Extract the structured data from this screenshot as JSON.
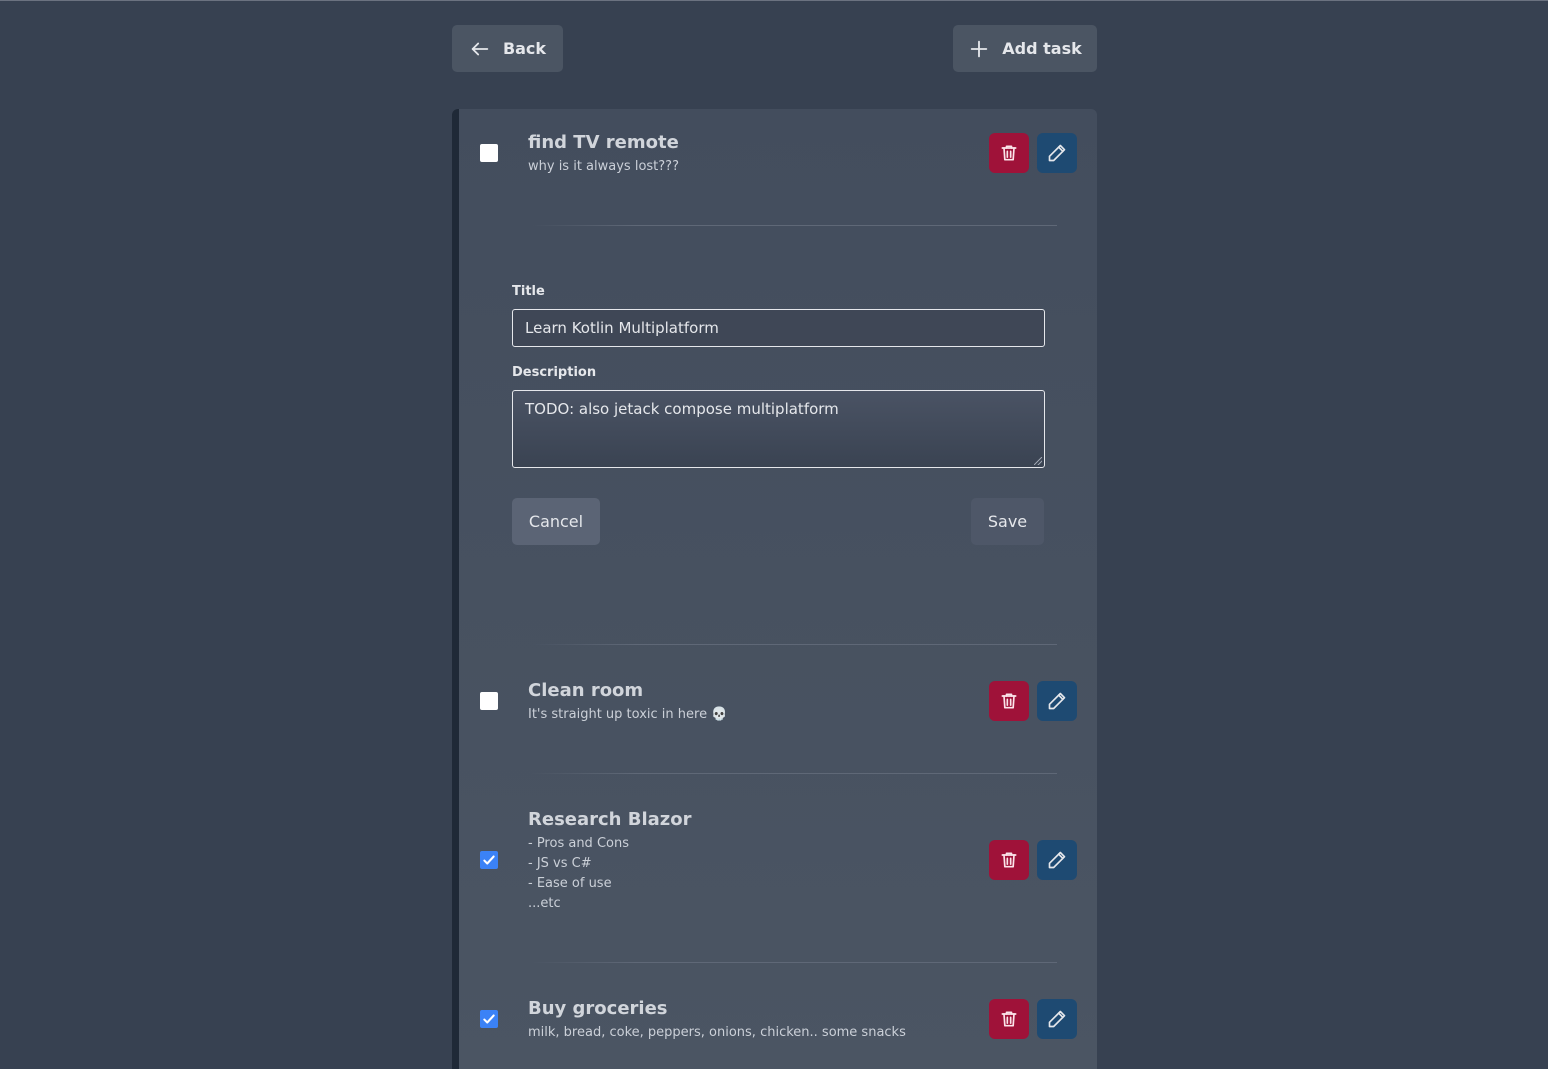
{
  "toolbar": {
    "back_label": "Back",
    "add_label": "Add task"
  },
  "tasks": [
    {
      "title": "find TV remote",
      "description": "why is it always lost???",
      "done": false
    },
    {
      "title": "Clean room",
      "description": "It's straight up toxic in here 💀",
      "done": false
    },
    {
      "title": "Research Blazor",
      "description": "- Pros and Cons\n- JS vs C#\n- Ease of use\n...etc",
      "done": true
    },
    {
      "title": "Buy groceries",
      "description": "milk, bread, coke, peppers, onions, chicken.. some snacks",
      "done": true
    }
  ],
  "edit_form": {
    "title_label": "Title",
    "title_value": "Learn Kotlin Multiplatform",
    "description_label": "Description",
    "description_value": "TODO: also jetack compose multiplatform",
    "cancel_label": "Cancel",
    "save_label": "Save"
  },
  "colors": {
    "background": "#374151",
    "panel": "#4b5563",
    "delete": "#9f1239",
    "edit": "#1e4a72",
    "checked": "#3b82f6"
  },
  "icons": {
    "back": "arrow-left-icon",
    "add": "plus-icon",
    "delete": "trash-icon",
    "edit": "pencil-icon",
    "check": "check-icon"
  }
}
